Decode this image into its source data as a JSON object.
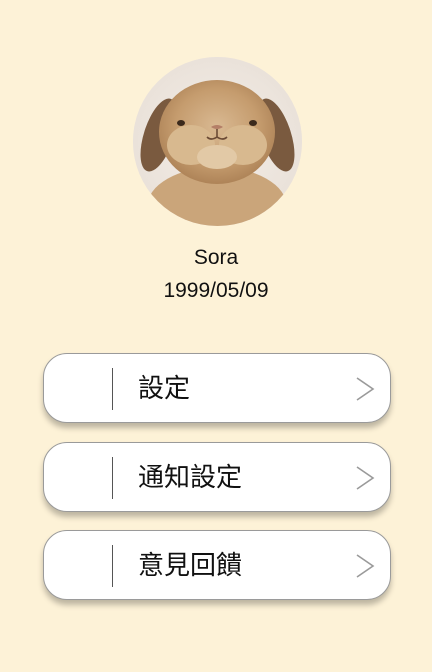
{
  "profile": {
    "name": "Sora",
    "birthday": "1999/05/09",
    "avatar_icon": "rabbit-avatar"
  },
  "menu": {
    "items": [
      {
        "label": "設定",
        "icon": "chevron-right-icon"
      },
      {
        "label": "通知設定",
        "icon": "chevron-right-icon"
      },
      {
        "label": "意見回饋",
        "icon": "chevron-right-icon"
      }
    ]
  },
  "colors": {
    "background": "#fdf2d7",
    "card": "#ffffff",
    "border": "#9a9a9a"
  }
}
